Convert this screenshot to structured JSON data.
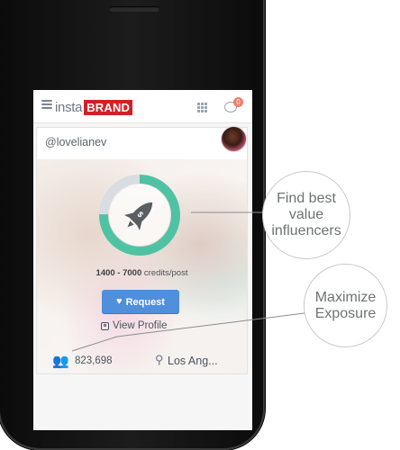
{
  "app": {
    "logo_prefix": "insta",
    "logo_brand": "BRAND",
    "notification_count": "0",
    "brand_color": "#d41f26"
  },
  "influencer": {
    "username": "@lovelianev",
    "credits_range": "1400 - 7000",
    "credits_unit": "credits/post",
    "request_label": "Request",
    "view_profile_label": "View Profile",
    "followers": "823,698",
    "location": "Los Ang..."
  },
  "icons": [
    "hamburger-menu-icon",
    "grid-icon",
    "chat-icon",
    "rocket-icon",
    "heart-icon",
    "instagram-icon",
    "followers-icon",
    "location-pin-icon"
  ],
  "colors": {
    "ring": "#4fc2a4",
    "ring_track": "#d7dde3",
    "button": "#4f8fdb"
  },
  "callouts": {
    "find_best": [
      "Find best",
      "value",
      "influencers"
    ],
    "maximize": [
      "Maximize",
      "Exposure"
    ]
  }
}
